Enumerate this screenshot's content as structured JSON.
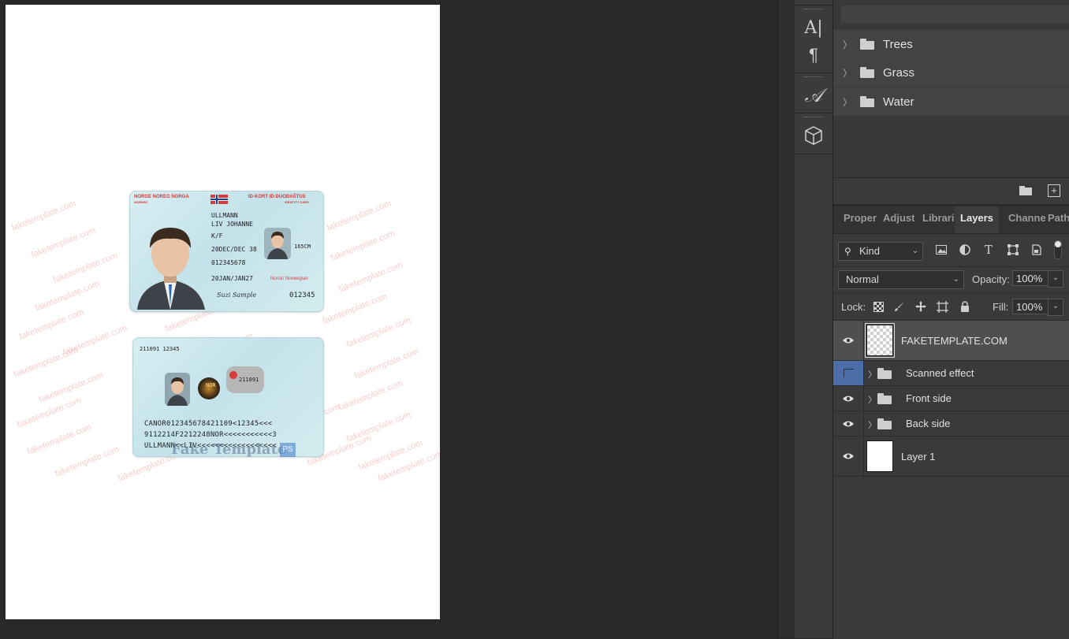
{
  "canvas": {
    "watermark_text": "faketemplate.com",
    "id_front": {
      "header_left": "NORGE NOREG NORGA",
      "header_left_sub": "NORWAY",
      "header_right": "ID-KORT ID-DUOĐAŠTUS",
      "header_right_sub": "IDENTITY CARD",
      "surname": "ULLMANN",
      "given_names": "LIV JOHANNE",
      "sex": "K/F",
      "date_of_birth": "20DEC/DEC 38",
      "height": "165CM",
      "personal_number": "012345678",
      "expiry": "20JAN/JAN27",
      "nationality": "Norsk/ Norwegian",
      "card_number": "012345",
      "signature": "Suzi Sample"
    },
    "id_back": {
      "top_number": "211091 12345",
      "ghost_number": "211091",
      "nor_emblem": "NOR",
      "mrz_line1": "CANOR012345678421109<12345<<<",
      "mrz_line2": "9112214F2212248NOR<<<<<<<<<<<3",
      "mrz_line3": "ULLMANN<<LIV<<<<<<<<<<<<<<<<<<",
      "overlay_text": "Fake Template",
      "overlay_badge": "PS"
    }
  },
  "toolbar": {
    "tools": [
      {
        "icon": "character-icon",
        "glyph": "A|"
      },
      {
        "icon": "paragraph-icon",
        "glyph": "¶"
      },
      {
        "icon": "glyphs-icon",
        "glyph": "𝒜"
      },
      {
        "icon": "3d-cube-icon",
        "glyph": "⬡"
      }
    ]
  },
  "brushes_panel": {
    "groups": [
      {
        "label": "Trees"
      },
      {
        "label": "Grass"
      },
      {
        "label": "Water"
      }
    ]
  },
  "tabs": [
    "Proper",
    "Adjust",
    "Librari",
    "Layers",
    "Channe",
    "Path"
  ],
  "active_tab": "Layers",
  "layers_panel": {
    "filter_kind": "Kind",
    "blend_mode": "Normal",
    "opacity_label": "Opacity:",
    "opacity_value": "100%",
    "lock_label": "Lock:",
    "fill_label": "Fill:",
    "fill_value": "100%",
    "layers": [
      {
        "name": "FAKETEMPLATE.COM",
        "type": "layer",
        "visible": true,
        "selected": true
      },
      {
        "name": "Scanned effect",
        "type": "group",
        "visible": false,
        "selected": false
      },
      {
        "name": "Front side",
        "type": "group",
        "visible": true,
        "selected": false
      },
      {
        "name": "Back side",
        "type": "group",
        "visible": true,
        "selected": false
      },
      {
        "name": "Layer 1",
        "type": "layer",
        "visible": true,
        "selected": false
      }
    ]
  },
  "colors": {
    "app_bg": "#282828",
    "panel_bg": "#3a3a3a",
    "accent_red": "#d63a3a",
    "hidden_layer_blue": "#4b6ea8"
  }
}
